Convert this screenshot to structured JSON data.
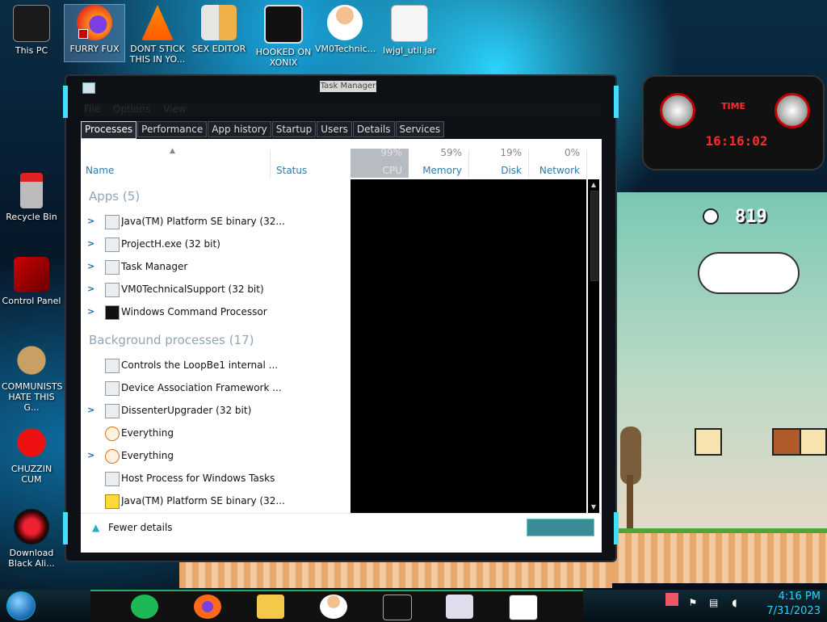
{
  "desktop": {
    "graffiti": "",
    "icons": [
      {
        "label": "This PC",
        "icon": "computer-icon"
      },
      {
        "label": "FURRY FUX",
        "icon": "firefox-icon"
      },
      {
        "label": "DONT STICK THIS IN YO...",
        "icon": "vlc-icon"
      },
      {
        "label": "SEX EDITOR",
        "icon": "hxd-icon"
      },
      {
        "label": "HOOKED ON XONIX",
        "icon": "game-icon"
      },
      {
        "label": "VM0Technic...",
        "icon": "doctor-icon"
      },
      {
        "label": "lwjgl_util.jar",
        "icon": "java-icon"
      },
      {
        "label": "Recycle Bin",
        "icon": "recycle-bin-icon"
      },
      {
        "label": "Control Panel",
        "icon": "control-panel-icon"
      },
      {
        "label": "COMMUNISTS HATE THIS G...",
        "icon": "money-bag-icon"
      },
      {
        "label": "CHUZZIN CUM",
        "icon": "chuzzle-icon"
      },
      {
        "label": "Download Black Ali...",
        "icon": "alienware-icon"
      }
    ]
  },
  "widget": {
    "title": "TIME",
    "time": "16:16:02"
  },
  "game": {
    "clock": "819"
  },
  "task_manager": {
    "title": "Task Manager",
    "menu": [
      "File",
      "Options",
      "View"
    ],
    "tabs": [
      "Processes",
      "Performance",
      "App history",
      "Startup",
      "Users",
      "Details",
      "Services"
    ],
    "active_tab": "Processes",
    "columns": {
      "name": "Name",
      "status": "Status",
      "cpu": {
        "pct": "99%",
        "label": "CPU"
      },
      "memory": {
        "pct": "59%",
        "label": "Memory"
      },
      "disk": {
        "pct": "19%",
        "label": "Disk"
      },
      "network": {
        "pct": "0%",
        "label": "Network"
      }
    },
    "groups": [
      {
        "title": "Apps (5)",
        "rows": [
          {
            "name": "Java(TM) Platform SE binary (32...",
            "expand": true,
            "icon": "java-icon"
          },
          {
            "name": "ProjectH.exe (32 bit)",
            "expand": true,
            "icon": "app-icon"
          },
          {
            "name": "Task Manager",
            "expand": true,
            "icon": "task-manager-icon"
          },
          {
            "name": "VM0TechnicalSupport (32 bit)",
            "expand": true,
            "icon": "doctor-icon"
          },
          {
            "name": "Windows Command Processor",
            "expand": true,
            "icon": "cmd-icon"
          }
        ]
      },
      {
        "title": "Background processes (17)",
        "rows": [
          {
            "name": "Controls the LoopBe1 internal ...",
            "expand": false,
            "icon": "midi-icon"
          },
          {
            "name": "Device Association Framework ...",
            "expand": false,
            "icon": "service-icon"
          },
          {
            "name": "DissenterUpgrader (32 bit)",
            "expand": true,
            "icon": "service-icon"
          },
          {
            "name": "Everything",
            "expand": false,
            "icon": "search-icon"
          },
          {
            "name": "Everything",
            "expand": true,
            "icon": "search-icon"
          },
          {
            "name": "Host Process for Windows Tasks",
            "expand": false,
            "icon": "service-icon"
          },
          {
            "name": "Java(TM) Platform SE binary (32...",
            "expand": false,
            "icon": "star-icon"
          }
        ]
      }
    ],
    "footer": {
      "fewer_details": "Fewer details",
      "end_task": ""
    }
  },
  "taskbar": {
    "items": [
      "spotify-icon",
      "firefox-icon",
      "file-explorer-icon",
      "doctor-icon",
      "cmd-icon",
      "java-icon",
      "game-icon"
    ],
    "active_item": "java-icon",
    "tray": [
      "firefox-tray-icon",
      "flag-icon",
      "network-icon",
      "volume-icon"
    ],
    "time": "4:16 PM",
    "date": "7/31/2023"
  }
}
